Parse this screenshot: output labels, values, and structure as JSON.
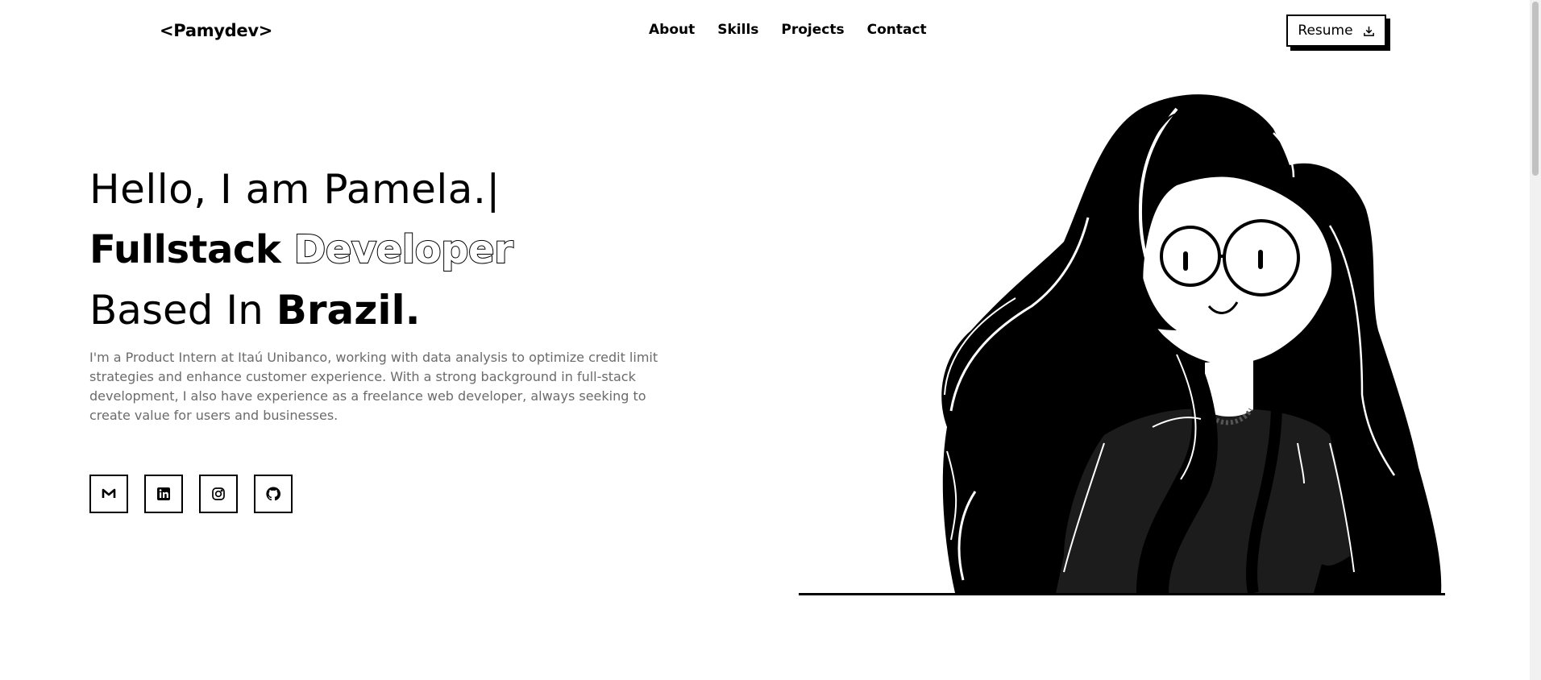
{
  "header": {
    "logo": "<Pamydev>",
    "nav": [
      "About",
      "Skills",
      "Projects",
      "Contact"
    ],
    "resume_label": "Resume"
  },
  "hero": {
    "greeting": "Hello, I am Pamela.|",
    "role_word1": "Fullstack",
    "role_word2": "Developer",
    "location_prefix": "Based In",
    "location": "Brazil.",
    "description": "I'm a Product Intern at Itaú Unibanco, working with data analysis to optimize credit limit strategies and enhance customer experience. With a strong background in full-stack development, I also have experience as a freelance web developer, always seeking to create value for users and businesses."
  },
  "social": [
    {
      "icon": "gmail-icon"
    },
    {
      "icon": "linkedin-icon"
    },
    {
      "icon": "instagram-icon"
    },
    {
      "icon": "github-icon"
    }
  ],
  "colors": {
    "text": "#000000",
    "muted": "#6b6b6b",
    "background": "#ffffff"
  }
}
